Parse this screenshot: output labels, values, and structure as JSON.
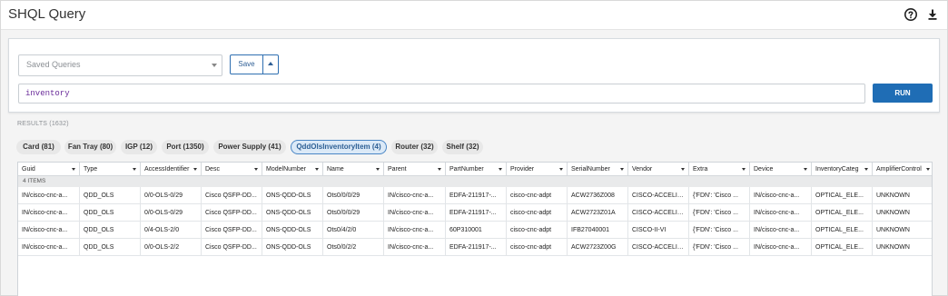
{
  "app": {
    "title": "SHQL Query"
  },
  "header_icons": [
    "help-icon",
    "download-icon"
  ],
  "query": {
    "saved_placeholder": "Saved Queries",
    "save_label": "Save",
    "input_value": "inventory",
    "run_label": "RUN"
  },
  "results": {
    "label": "RESULTS (1632)",
    "chips": [
      {
        "label": "Card (81)",
        "active": false
      },
      {
        "label": "Fan Tray (80)",
        "active": false
      },
      {
        "label": "IGP (12)",
        "active": false
      },
      {
        "label": "Port (1350)",
        "active": false
      },
      {
        "label": "Power Supply (41)",
        "active": false
      },
      {
        "label": "QddOlsInventoryItem (4)",
        "active": true
      },
      {
        "label": "Router (32)",
        "active": false
      },
      {
        "label": "Shelf (32)",
        "active": false
      }
    ]
  },
  "table": {
    "columns": [
      "Guid",
      "Type",
      "AccessIdentifier",
      "Desc",
      "ModelNumber",
      "Name",
      "Parent",
      "PartNumber",
      "Provider",
      "SerialNumber",
      "Vendor",
      "Extra",
      "Device",
      "InventoryCateg",
      "AmplifierControl"
    ],
    "group_label": "4 ITEMS",
    "rows": [
      [
        "IN/cisco-cnc-a...",
        "QDD_OLS",
        "0/0-OLS-0/29",
        "Cisco QSFP-DD...",
        "ONS-QDD-OLS",
        "Ots0/0/0/29",
        "IN/cisco-cnc-a...",
        "EDFA-211917-...",
        "cisco-cnc-adpt",
        "ACW2736Z008",
        "CISCO-ACCELINK",
        "{'FDN': 'Cisco ...",
        "IN/cisco-cnc-a...",
        "OPTICAL_ELE...",
        "UNKNOWN"
      ],
      [
        "IN/cisco-cnc-a...",
        "QDD_OLS",
        "0/0-OLS-0/29",
        "Cisco QSFP-DD...",
        "ONS-QDD-OLS",
        "Ots0/0/0/29",
        "IN/cisco-cnc-a...",
        "EDFA-211917-...",
        "cisco-cnc-adpt",
        "ACW2723Z01A",
        "CISCO-ACCELINK",
        "{'FDN': 'Cisco ...",
        "IN/cisco-cnc-a...",
        "OPTICAL_ELE...",
        "UNKNOWN"
      ],
      [
        "IN/cisco-cnc-a...",
        "QDD_OLS",
        "0/4-OLS-2/0",
        "Cisco QSFP-DD...",
        "ONS-QDD-OLS",
        "Ots0/4/2/0",
        "IN/cisco-cnc-a...",
        "60P310001",
        "cisco-cnc-adpt",
        "IFB27040001",
        "CISCO-II-VI",
        "{'FDN': 'Cisco ...",
        "IN/cisco-cnc-a...",
        "OPTICAL_ELE...",
        "UNKNOWN"
      ],
      [
        "IN/cisco-cnc-a...",
        "QDD_OLS",
        "0/0-OLS-2/2",
        "Cisco QSFP-DD...",
        "ONS-QDD-OLS",
        "Ots0/0/2/2",
        "IN/cisco-cnc-a...",
        "EDFA-211917-...",
        "cisco-cnc-adpt",
        "ACW2723Z00G",
        "CISCO-ACCELINK",
        "{'FDN': 'Cisco ...",
        "IN/cisco-cnc-a...",
        "OPTICAL_ELE...",
        "UNKNOWN"
      ]
    ]
  },
  "colors": {
    "accent": "#1f6db5",
    "active_chip_bg": "#dbe9f7"
  }
}
